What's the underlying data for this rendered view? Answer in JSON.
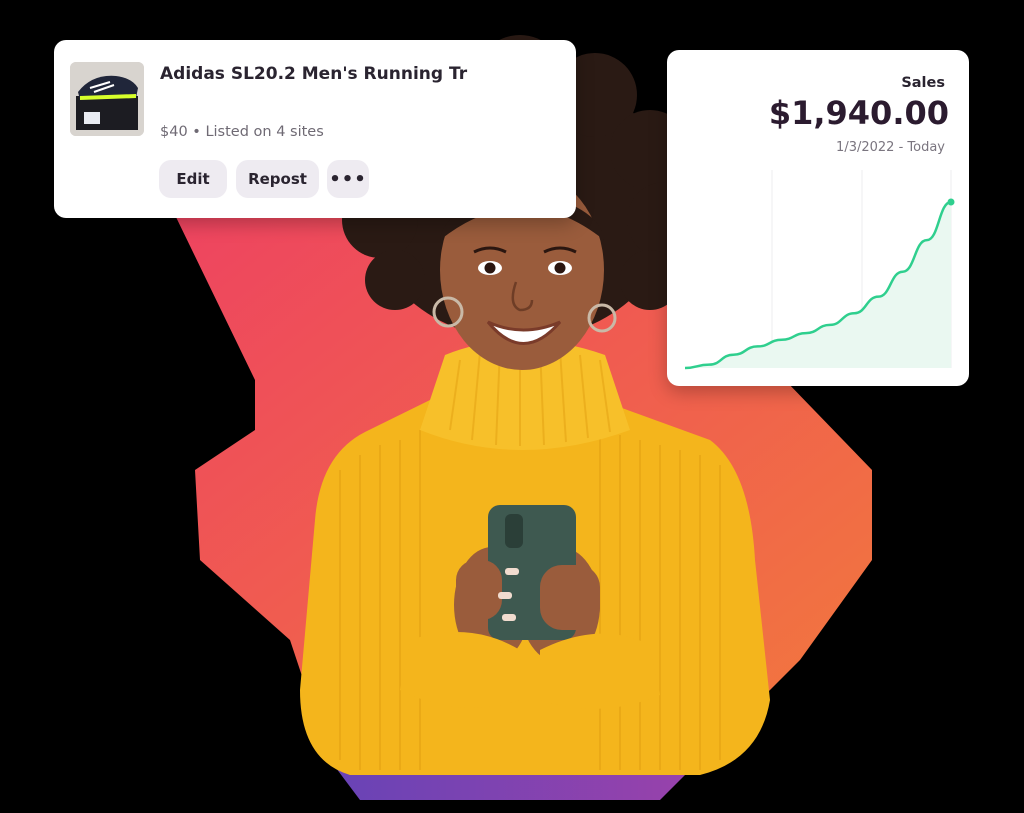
{
  "listing": {
    "title": "Adidas SL20.2 Men's Running Tr",
    "meta": "$40 • Listed on 4 sites",
    "actions": {
      "edit_label": "Edit",
      "repost_label": "Repost",
      "more_label": "•••"
    }
  },
  "sales": {
    "label": "Sales",
    "amount": "$1,940.00",
    "range": "1/3/2022 - Today"
  },
  "chart_data": {
    "type": "area",
    "title": "",
    "xlabel": "",
    "ylabel": "",
    "color": "#2fcf8e",
    "fill": "#eaf8f1",
    "series": [
      {
        "values": [
          0,
          2,
          8,
          13,
          17,
          21,
          26,
          33,
          43,
          58,
          77,
          100
        ]
      }
    ]
  },
  "colors": {
    "background": "#000000",
    "backdrop_gradient": [
      "#ef4a5e",
      "#f2763f"
    ],
    "sweater": "#f5b81e",
    "button_bg": "#eeebf1"
  },
  "icons": {
    "more": "ellipsis-icon",
    "product": "sneaker-box-thumbnail"
  }
}
